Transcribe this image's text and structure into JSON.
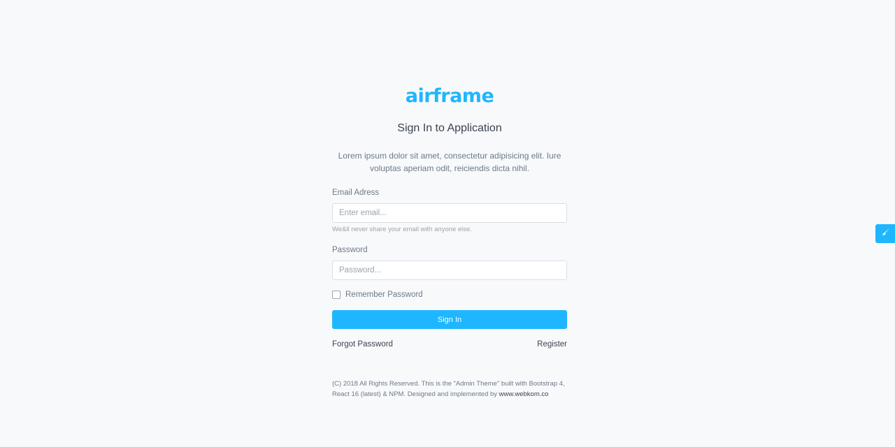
{
  "brand": {
    "logo_text": "airframe",
    "accent_color": "#1eb7ff"
  },
  "login": {
    "title": "Sign In to Application",
    "description": "Lorem ipsum dolor sit amet, consectetur adipisicing elit. Iure voluptas aperiam odit, reiciendis dicta nihil.",
    "email": {
      "label": "Email Adress",
      "placeholder": "Enter email...",
      "value": "",
      "help": "We&ll never share your email with anyone else."
    },
    "password": {
      "label": "Password",
      "placeholder": "Password...",
      "value": ""
    },
    "remember": {
      "label": "Remember Password",
      "checked": false
    },
    "submit_label": "Sign In",
    "forgot_label": "Forgot Password",
    "register_label": "Register"
  },
  "footer": {
    "text": "(C) 2018 All Rights Reserved. This is the \"Admin Theme\" built with Bootstrap 4, React 16 (latest) & NPM. Designed and implemented by ",
    "link_text": "www.webkom.co"
  },
  "side_tab": {
    "icon": "paint-brush-icon"
  }
}
